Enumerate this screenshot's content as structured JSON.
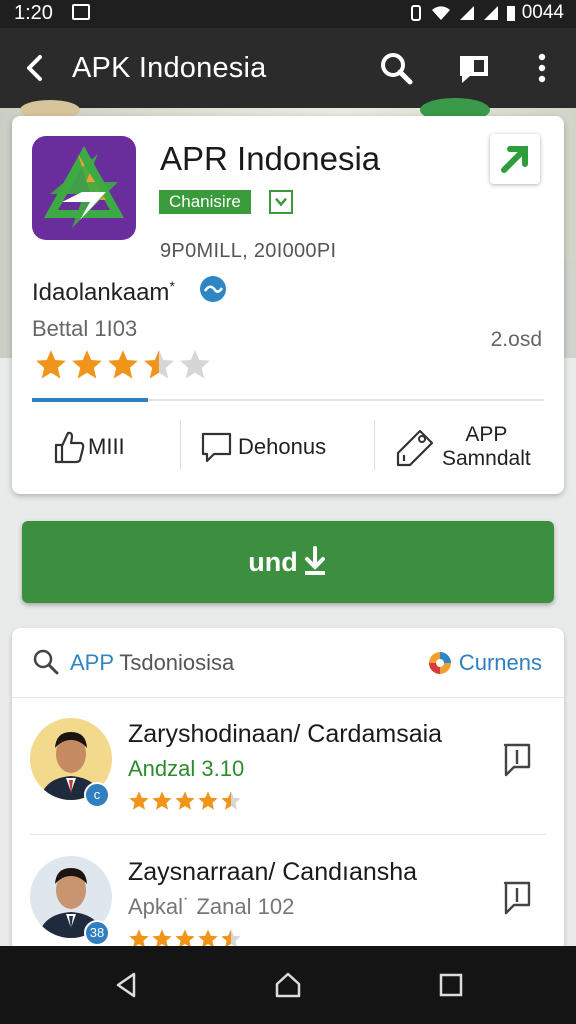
{
  "status_bar": {
    "time": "1:20",
    "clock_right": "0044"
  },
  "app_bar": {
    "title": "APK Indonesia"
  },
  "app": {
    "name": "APR Indonesia",
    "category_chip": "Chanisire",
    "date_line": "9P0MILL, 20I000PI",
    "developer": "Idaolankaam",
    "developer_mark": "*",
    "version": "Bettal  1I03",
    "size": "2.osd",
    "rating": 3.5
  },
  "card_actions": [
    {
      "label": "MIII",
      "icon": "thumb-up-icon"
    },
    {
      "label": "Dehonus",
      "icon": "comment-icon"
    },
    {
      "label": "APP\nSamndalt",
      "icon": "tag-icon"
    }
  ],
  "install": {
    "label": "und"
  },
  "reviews": {
    "search_accent": "APP",
    "search_rest": " Tsdoniosisa",
    "current_label": "Curnens",
    "items": [
      {
        "name": "Zaryshodinaan/ Cardamsaia",
        "subtitle": "Andzal  3.10",
        "subtitle_color": "#2e8b2e",
        "rating": 4.5,
        "badge": "c"
      },
      {
        "name": "Zaysnarraan/ Candıansha",
        "subtitle": "Apkal˙ Zanal 102",
        "subtitle_color": "#777777",
        "rating": 4.5,
        "badge": "38"
      }
    ]
  },
  "colors": {
    "accent_green": "#3b8f3f",
    "accent_blue": "#2f7fc1",
    "star": "#f0951a"
  }
}
